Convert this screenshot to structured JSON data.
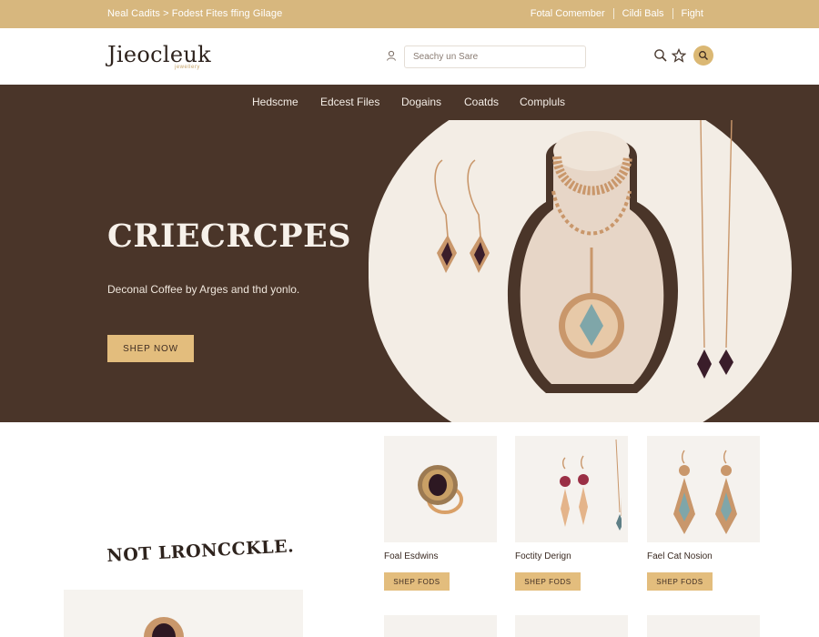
{
  "topbar": {
    "left_text": "Neal Cadits > Fodest  Fites ffing Gilage",
    "right_links": [
      "Fotal Comember",
      "Cildi Bals",
      "Fight"
    ]
  },
  "header": {
    "logo": "Jieocleuk",
    "logo_sub": "jewellery",
    "search_placeholder": "Seachy un Sare",
    "icons": [
      "user-icon",
      "search-icon",
      "star-icon",
      "account-icon"
    ]
  },
  "nav": {
    "items": [
      "Hedscme",
      "Edcest Files",
      "Dogains",
      "Coatds",
      "Compluls"
    ]
  },
  "hero": {
    "title": "CRIECRCPES",
    "subtitle": "Deconal Coffee by Arges and thd yonlo.",
    "button": "SHEP NOW"
  },
  "section": {
    "title": "NOT LRONCCKLE."
  },
  "products": [
    {
      "name": "Foal Esdwins",
      "button": "SHEP FODS",
      "icon": "ring-icon"
    },
    {
      "name": "Foctity Derign",
      "button": "SHEP FODS",
      "icon": "drop-earrings-icon"
    },
    {
      "name": "Fael Cat Nosion",
      "button": "SHEP FODS",
      "icon": "chandelier-earrings-icon"
    }
  ],
  "colors": {
    "accent": "#d7b77e",
    "button": "#e3bd7d",
    "dark_brown": "#4a3529",
    "cream": "#f3ede5",
    "gold": "#c9976b",
    "gem_purple": "#3a1d2a",
    "gem_teal": "#7fa6a9"
  }
}
